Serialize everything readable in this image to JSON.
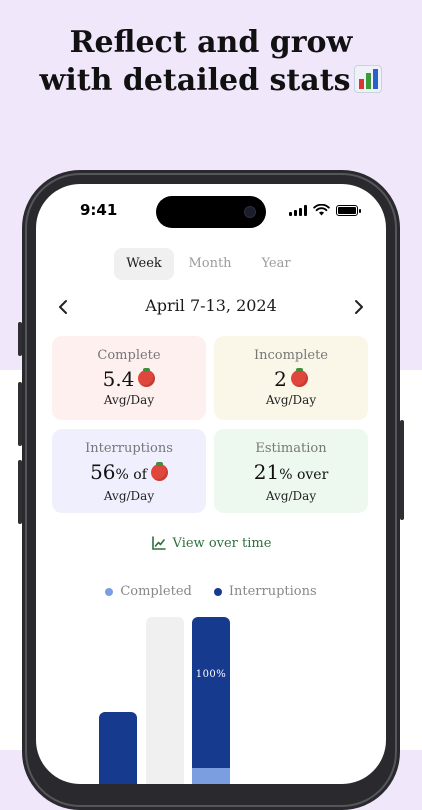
{
  "headline": {
    "line1": "Reflect and grow",
    "line2": "with detailed stats"
  },
  "status_bar": {
    "time": "9:41"
  },
  "tabs": [
    {
      "label": "Week",
      "active": true
    },
    {
      "label": "Month",
      "active": false
    },
    {
      "label": "Year",
      "active": false
    }
  ],
  "date_range": "April 7-13, 2024",
  "cards": {
    "complete": {
      "title": "Complete",
      "value": "5.4",
      "sub": "Avg/Day",
      "bg": "#fdf0ef"
    },
    "incomplete": {
      "title": "Incomplete",
      "value": "2",
      "sub": "Avg/Day",
      "bg": "#fbf7e8"
    },
    "interruptions": {
      "title": "Interruptions",
      "value": "56",
      "value_suffix": "% of",
      "sub": "Avg/Day",
      "bg": "#f0effd"
    },
    "estimation": {
      "title": "Estimation",
      "value": "21",
      "value_suffix": "% over",
      "sub": "Avg/Day",
      "bg": "#edf9ee"
    }
  },
  "view_over_time": "View over time",
  "legend": [
    {
      "label": "Completed",
      "color": "#7b9ee0"
    },
    {
      "label": "Interruptions",
      "color": "#163a8e"
    }
  ],
  "chart_data": {
    "type": "bar",
    "stacked": true,
    "series": [
      {
        "name": "Completed",
        "color": "#7b9ee0"
      },
      {
        "name": "Interruptions",
        "color": "#163a8e"
      }
    ],
    "data_labels": [
      "100%"
    ]
  },
  "colors": {
    "accent_green": "#2e6f3e",
    "tomato": "#e0473c",
    "background_top": "#f1e7fb"
  }
}
